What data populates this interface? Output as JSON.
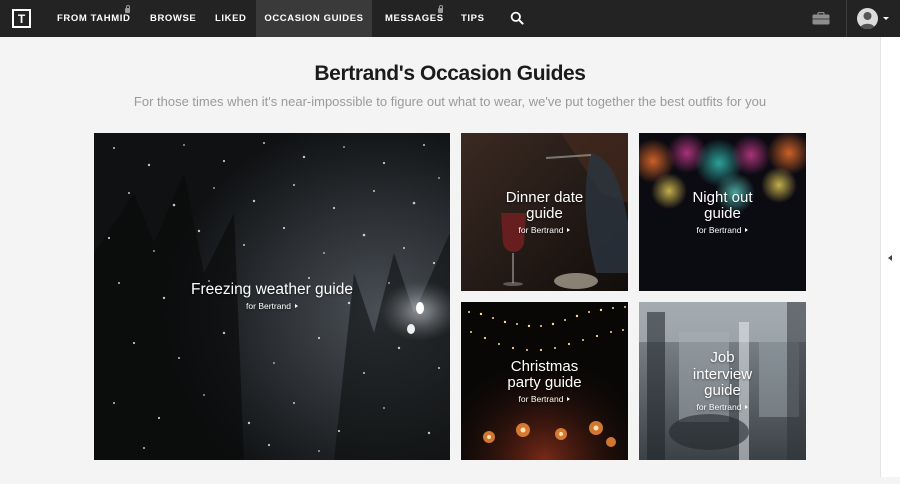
{
  "nav": {
    "logo": "T",
    "items": [
      {
        "label": "FROM TAHMID",
        "locked": true
      },
      {
        "label": "BROWSE",
        "locked": false
      },
      {
        "label": "LIKED",
        "locked": false
      },
      {
        "label": "OCCASION GUIDES",
        "locked": false,
        "active": true
      },
      {
        "label": "MESSAGES",
        "locked": true
      },
      {
        "label": "TIPS",
        "locked": false
      }
    ],
    "icons": [
      "search-icon",
      "wardrobe-icon",
      "avatar",
      "chevron-down-icon"
    ]
  },
  "header": {
    "title": "Bertrand's Occasion Guides",
    "subtitle": "For those times when it's near-impossible to figure out what to wear, we've put together the best outfits for you"
  },
  "guides": [
    {
      "title": "Freezing weather guide",
      "sub": "for Bertrand"
    },
    {
      "title": "Dinner date guide",
      "sub": "for Bertrand"
    },
    {
      "title": "Night out guide",
      "sub": "for Bertrand"
    },
    {
      "title": "Christmas party guide",
      "sub": "for Bertrand"
    },
    {
      "title": "Job interview guide",
      "sub": "for Bertrand"
    }
  ],
  "colors": {
    "nav_bg": "#232323",
    "nav_active": "#3a3a3a",
    "page_bg": "#f4f4f4",
    "title": "#1b1b1b",
    "subtitle": "#9a9a9a"
  }
}
